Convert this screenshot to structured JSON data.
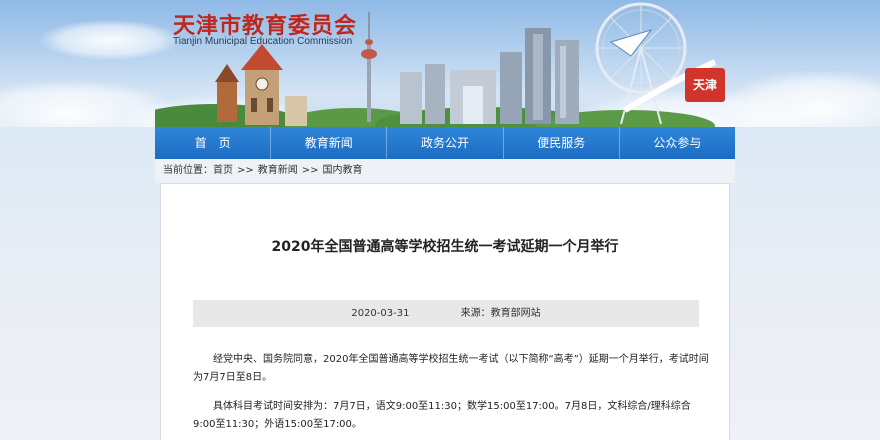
{
  "site": {
    "title": "天津市教育委员会",
    "subtitle": "Tianjin Municipal Education Commission"
  },
  "nav": {
    "items": [
      {
        "label": "首　页"
      },
      {
        "label": "教育新闻"
      },
      {
        "label": "政务公开"
      },
      {
        "label": "便民服务"
      },
      {
        "label": "公众参与"
      }
    ]
  },
  "breadcrumb": {
    "label": "当前位置：",
    "items": [
      "首页",
      "教育新闻",
      "国内教育"
    ],
    "separator": ">>"
  },
  "article": {
    "title": "2020年全国普通高等学校招生统一考试延期一个月举行",
    "date": "2020-03-31",
    "source_label": "来源：",
    "source": "教育部网站",
    "paragraphs": [
      "经党中央、国务院同意，2020年全国普通高等学校招生统一考试（以下简称“高考”）延期一个月举行，考试时间为7月7日至8日。",
      "具体科目考试时间安排为：7月7日，语文9:00至11:30；数学15:00至17:00。7月8日，文科综合/理科综合9:00至11:30；外语15:00至17:00。"
    ]
  },
  "banner": {
    "stamp_text": "天津",
    "accent_color": "#c0271c",
    "nav_color": "#1c6cc4"
  }
}
